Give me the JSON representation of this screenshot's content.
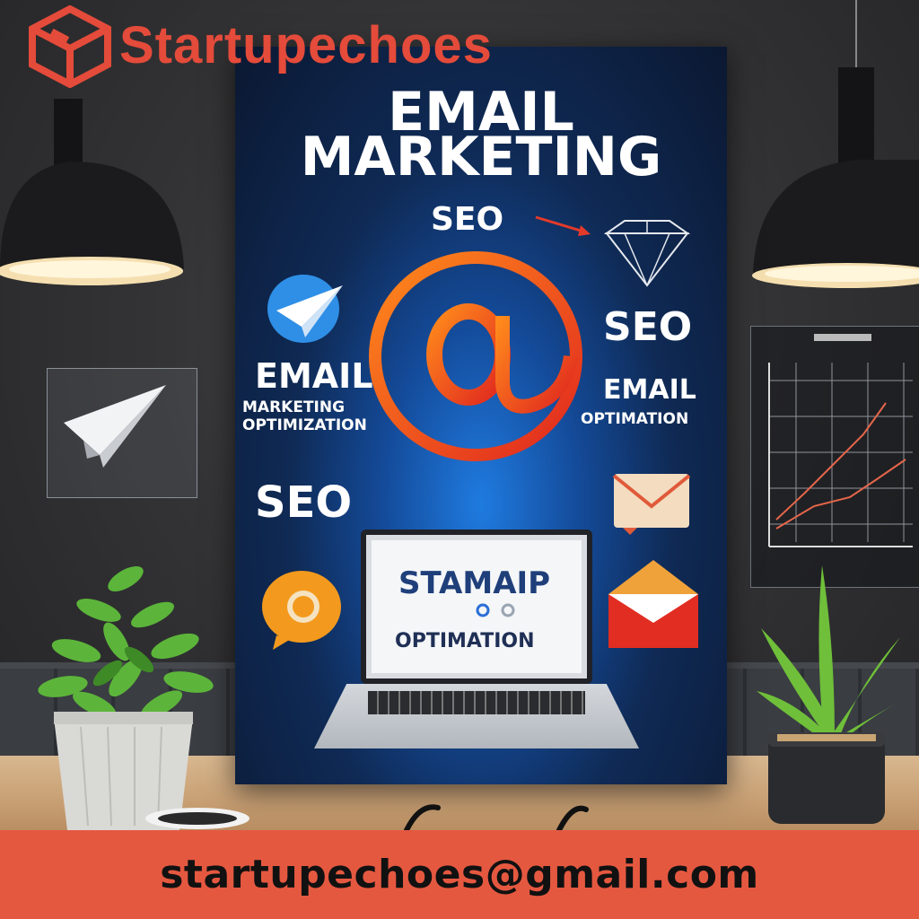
{
  "brand": {
    "name": "Startupechoes",
    "icon": "cube-logo-icon",
    "color": "#e44b3a"
  },
  "poster": {
    "title_line1": "EMAIL",
    "title_line2": "MARKETING",
    "seo_top": "SEO",
    "seo_right": "SEO",
    "seo_left": "SEO",
    "email_left": "EMAIL",
    "email_left_sub1": "MARKETING",
    "email_left_sub2": "OPTIMIZATION",
    "email_right": "EMAIL",
    "email_right_sub": "OPTIMATION",
    "laptop_screen_line1": "STAMAIP",
    "laptop_screen_line2": "OPTIMATION",
    "icons": [
      "at-sign-icon",
      "paper-plane-icon",
      "diamond-icon",
      "envelope-icon",
      "open-envelope-icon",
      "chat-bubble-icon",
      "laptop-icon"
    ]
  },
  "footer": {
    "email": "startupechoes@gmail.com",
    "background": "#e55840"
  }
}
